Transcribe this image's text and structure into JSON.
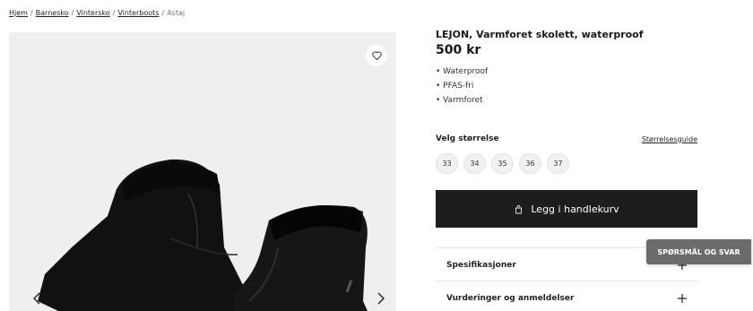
{
  "breadcrumb": {
    "items": [
      "Hjem",
      "Barnesko",
      "Vintersko",
      "Vinterboots"
    ],
    "current": "Astaj",
    "separator": "/"
  },
  "gallery": {
    "favorite_icon": "heart-icon",
    "prev_icon": "chevron-left-icon",
    "next_icon": "chevron-right-icon"
  },
  "product": {
    "title": "LEJON, Varmforet skolett, waterproof",
    "price": "500 kr",
    "features": [
      "Waterproof",
      "PFAS-fri",
      "Varmforet"
    ]
  },
  "sizes": {
    "label": "Velg størrelse",
    "guide": "Størrelsesguide",
    "options": [
      "33",
      "34",
      "35",
      "36",
      "37"
    ]
  },
  "cart": {
    "label": "Legg i handlekurv",
    "icon": "shopping-bag-icon"
  },
  "accordions": {
    "specs": "Spesifikasjoner",
    "reviews": "Vurderinger og anmeldelser",
    "expand_icon": "plus-icon"
  },
  "qa": {
    "label": "SPØRSMÅL OG SVAR"
  },
  "colors": {
    "primary": "#1d1d1d",
    "qa_background": "#6b6b6b",
    "gallery_background": "#efefef"
  }
}
